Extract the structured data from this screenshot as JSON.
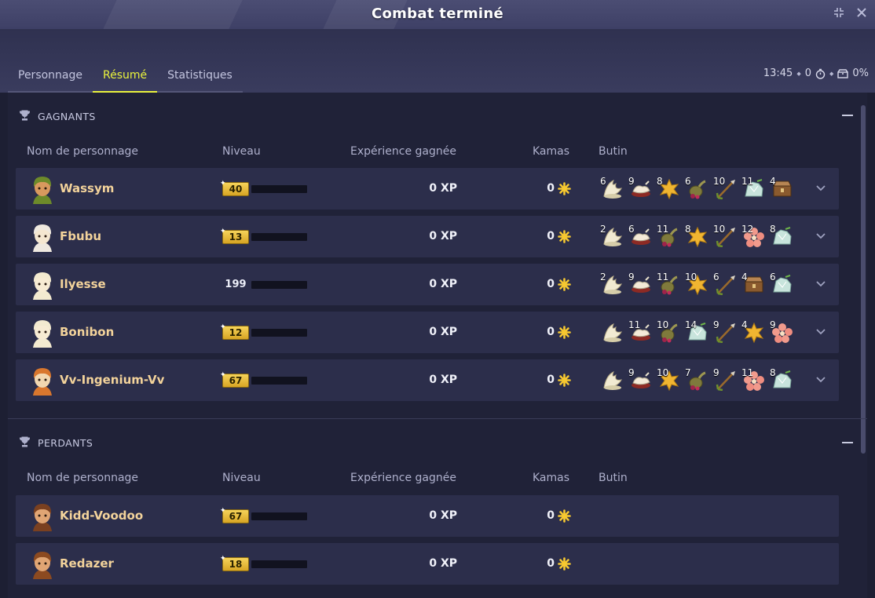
{
  "window": {
    "title": "Combat terminé"
  },
  "tabs": [
    {
      "label": "Personnage"
    },
    {
      "label": "Résumé",
      "active": true
    },
    {
      "label": "Statistiques"
    }
  ],
  "status": {
    "time": "13:45",
    "turns": "0",
    "percent": "0%"
  },
  "columns": {
    "name": "Nom de personnage",
    "level": "Niveau",
    "xp": "Expérience gagnée",
    "kamas": "Kamas",
    "loot": "Butin"
  },
  "winners": {
    "title": "GAGNANTS",
    "rows": [
      {
        "name": "Wassym",
        "level": "40",
        "badge": true,
        "xp": "0 XP",
        "kamas": "0",
        "loot": [
          {
            "qty": "6",
            "icon": "shell-icon"
          },
          {
            "qty": "9",
            "icon": "meat-icon"
          },
          {
            "qty": "8",
            "icon": "leaf-icon"
          },
          {
            "qty": "6",
            "icon": "gourd-icon"
          },
          {
            "qty": "10",
            "icon": "arrow-icon"
          },
          {
            "qty": "11",
            "icon": "crystal-icon"
          },
          {
            "qty": "4",
            "icon": "chest-icon"
          }
        ]
      },
      {
        "name": "Fbubu",
        "level": "13",
        "badge": true,
        "xp": "0 XP",
        "kamas": "0",
        "loot": [
          {
            "qty": "2",
            "icon": "shell-icon"
          },
          {
            "qty": "6",
            "icon": "meat-icon"
          },
          {
            "qty": "11",
            "icon": "gourd-icon"
          },
          {
            "qty": "8",
            "icon": "leaf-icon"
          },
          {
            "qty": "10",
            "icon": "arrow-icon"
          },
          {
            "qty": "12",
            "icon": "flower-icon"
          },
          {
            "qty": "8",
            "icon": "crystal-icon"
          }
        ]
      },
      {
        "name": "Ilyesse",
        "level": "199",
        "badge": false,
        "xp": "0 XP",
        "kamas": "0",
        "loot": [
          {
            "qty": "2",
            "icon": "shell-icon"
          },
          {
            "qty": "9",
            "icon": "meat-icon"
          },
          {
            "qty": "11",
            "icon": "gourd-icon"
          },
          {
            "qty": "10",
            "icon": "leaf-icon"
          },
          {
            "qty": "6",
            "icon": "arrow-icon"
          },
          {
            "qty": "4",
            "icon": "chest-icon"
          },
          {
            "qty": "6",
            "icon": "crystal-icon"
          }
        ]
      },
      {
        "name": "Bonibon",
        "level": "12",
        "badge": true,
        "xp": "0 XP",
        "kamas": "0",
        "loot": [
          {
            "qty": "",
            "icon": "shell-icon"
          },
          {
            "qty": "11",
            "icon": "meat-icon"
          },
          {
            "qty": "10",
            "icon": "gourd-icon"
          },
          {
            "qty": "14",
            "icon": "crystal-icon"
          },
          {
            "qty": "9",
            "icon": "arrow-icon"
          },
          {
            "qty": "4",
            "icon": "leaf-icon"
          },
          {
            "qty": "9",
            "icon": "flower-icon"
          }
        ]
      },
      {
        "name": "Vv-Ingenium-Vv",
        "level": "67",
        "badge": true,
        "xp": "0 XP",
        "kamas": "0",
        "loot": [
          {
            "qty": "",
            "icon": "shell-icon"
          },
          {
            "qty": "9",
            "icon": "meat-icon"
          },
          {
            "qty": "10",
            "icon": "leaf-icon"
          },
          {
            "qty": "7",
            "icon": "gourd-icon"
          },
          {
            "qty": "9",
            "icon": "arrow-icon"
          },
          {
            "qty": "11",
            "icon": "flower-icon"
          },
          {
            "qty": "8",
            "icon": "crystal-icon"
          }
        ]
      }
    ]
  },
  "losers": {
    "title": "PERDANTS",
    "rows": [
      {
        "name": "Kidd-Voodoo",
        "level": "67",
        "badge": true,
        "xp": "0 XP",
        "kamas": "0",
        "loot": []
      },
      {
        "name": "Redazer",
        "level": "18",
        "badge": true,
        "xp": "0 XP",
        "kamas": "0",
        "loot": []
      }
    ]
  },
  "colors": {
    "accent": "#e9f23d",
    "name": "#f3d39b",
    "row": "#2c2e4b",
    "gold": "#f6c830"
  }
}
